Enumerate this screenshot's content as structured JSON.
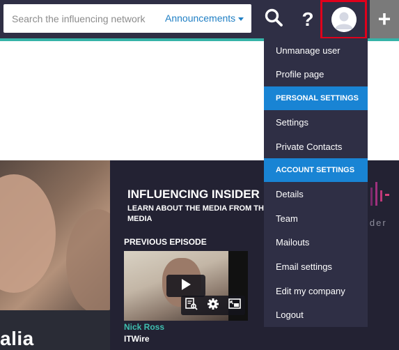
{
  "search": {
    "placeholder": "Search the influencing network"
  },
  "header": {
    "announcements_label": "Announcements",
    "help_label": "?",
    "add_label": "+"
  },
  "menu": {
    "items": [
      {
        "type": "item",
        "label": "Unmanage user",
        "name": "menu-item-unmanage-user"
      },
      {
        "type": "item",
        "label": "Profile page",
        "name": "menu-item-profile-page"
      },
      {
        "type": "header",
        "label": "PERSONAL SETTINGS",
        "name": "menu-section-personal-settings"
      },
      {
        "type": "item",
        "label": "Settings",
        "name": "menu-item-settings"
      },
      {
        "type": "item",
        "label": "Private Contacts",
        "name": "menu-item-private-contacts"
      },
      {
        "type": "header",
        "label": "ACCOUNT SETTINGS",
        "name": "menu-section-account-settings"
      },
      {
        "type": "item",
        "label": "Details",
        "name": "menu-item-details"
      },
      {
        "type": "item",
        "label": "Team",
        "name": "menu-item-team"
      },
      {
        "type": "item",
        "label": "Mailouts",
        "name": "menu-item-mailouts"
      },
      {
        "type": "item",
        "label": "Email settings",
        "name": "menu-item-email-settings"
      },
      {
        "type": "item",
        "label": "Edit my company",
        "name": "menu-item-edit-my-company"
      },
      {
        "type": "item",
        "label": "Logout",
        "name": "menu-item-logout"
      }
    ]
  },
  "hero": {
    "photo_caption": "alia",
    "title": "INFLUENCING INSIDER",
    "subtitle": "LEARN ABOUT THE MEDIA FROM THE MEDIA",
    "previous_label": "PREVIOUS EPISODE",
    "author": "Nick Ross",
    "outlet": "ITWire",
    "logo_text": "ider"
  },
  "colors": {
    "topbar": "#2f2f45",
    "teal_accent": "#36b3a8",
    "menu_header": "#1984d4",
    "highlight_border": "#e0001b",
    "link": "#1f7fc4"
  },
  "icons": {
    "search": "search-icon",
    "help": "help-icon",
    "avatar": "user-avatar-icon",
    "add": "plus-icon",
    "play": "play-icon",
    "transcript": "transcript-icon",
    "settings": "gear-icon",
    "pip": "picture-in-picture-icon"
  }
}
